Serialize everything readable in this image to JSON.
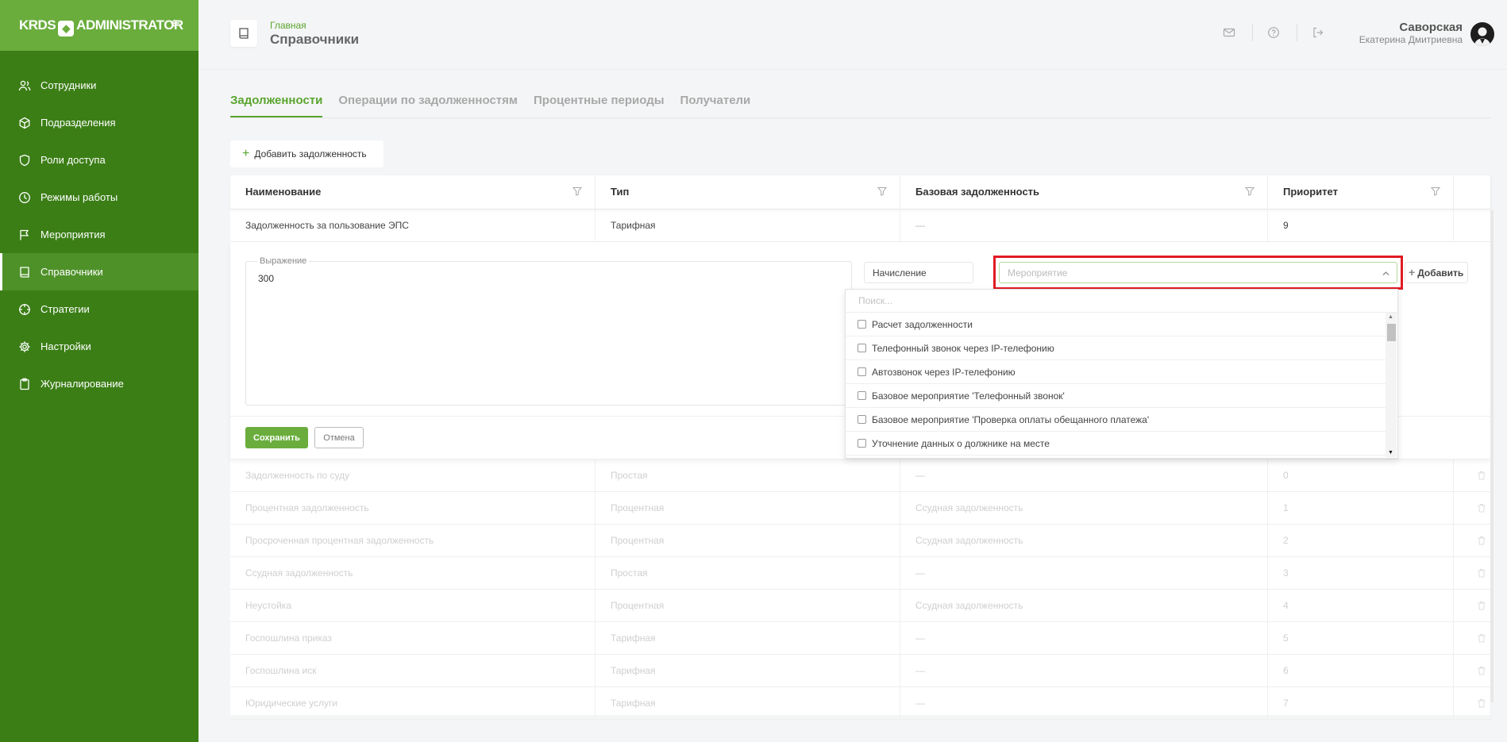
{
  "brand": {
    "logo_left": "KRDS",
    "logo_right": "ADMINISTRATOR",
    "collapse_icon": "arrow-left-icon"
  },
  "sidebar": {
    "items": [
      {
        "label": "Сотрудники",
        "icon": "users-icon",
        "active": false
      },
      {
        "label": "Подразделения",
        "icon": "cube-icon",
        "active": false
      },
      {
        "label": "Роли доступа",
        "icon": "shield-icon",
        "active": false
      },
      {
        "label": "Режимы работы",
        "icon": "clock-icon",
        "active": false
      },
      {
        "label": "Мероприятия",
        "icon": "flag-icon",
        "active": false
      },
      {
        "label": "Справочники",
        "icon": "book-icon",
        "active": true
      },
      {
        "label": "Стратегии",
        "icon": "crosshair-icon",
        "active": false
      },
      {
        "label": "Настройки",
        "icon": "gear-icon",
        "active": false
      },
      {
        "label": "Журналирование",
        "icon": "clipboard-icon",
        "active": false
      }
    ]
  },
  "header": {
    "breadcrumb_home": "Главная",
    "page_title": "Справочники",
    "user_last_name": "Саворская",
    "user_first_name": "Екатерина Дмитриевна"
  },
  "tabs": [
    {
      "label": "Задолженности",
      "active": true
    },
    {
      "label": "Операции по задолженностям",
      "active": false
    },
    {
      "label": "Процентные периоды",
      "active": false
    },
    {
      "label": "Получатели",
      "active": false
    }
  ],
  "add_button": {
    "label": "Добавить задолженность"
  },
  "table": {
    "columns": [
      "Наименование",
      "Тип",
      "Базовая задолженность",
      "Приоритет"
    ],
    "expanded_row": {
      "name": "Задолженность за пользование ЭПС",
      "type": "Тарифная",
      "base": "—",
      "priority": "9"
    },
    "rows": [
      {
        "name": "Задолженность по суду",
        "type": "Простая",
        "base": "—",
        "priority": "0"
      },
      {
        "name": "Процентная задолженность",
        "type": "Процентная",
        "base": "Ссудная задолженность",
        "priority": "1"
      },
      {
        "name": "Просроченная процентная задолженность",
        "type": "Процентная",
        "base": "Ссудная задолженность",
        "priority": "2"
      },
      {
        "name": "Ссудная задолженность",
        "type": "Простая",
        "base": "—",
        "priority": "3"
      },
      {
        "name": "Неустойка",
        "type": "Процентная",
        "base": "Ссудная задолженность",
        "priority": "4"
      },
      {
        "name": "Госпошлина приказ",
        "type": "Тарифная",
        "base": "—",
        "priority": "5"
      },
      {
        "name": "Госпошлина иск",
        "type": "Тарифная",
        "base": "—",
        "priority": "6"
      },
      {
        "name": "Юридические услуги",
        "type": "Тарифная",
        "base": "—",
        "priority": "7"
      }
    ]
  },
  "edit_form": {
    "expression_label": "Выражение",
    "expression_value": "300",
    "accrual_select": "Начисление",
    "event_placeholder": "Мероприятие",
    "add_label": "Добавить",
    "save_label": "Сохранить",
    "cancel_label": "Отмена"
  },
  "dropdown": {
    "search_placeholder": "Поиск...",
    "options": [
      "Расчет задолженности",
      "Телефонный звонок через IP-телефонию",
      "Автозвонок через IP-телефонию",
      "Базовое мероприятие 'Телефонный звонок'",
      "Базовое мероприятие 'Проверка оплаты обещанного платежа'",
      "Уточнение данных о должнике на месте"
    ]
  },
  "colors": {
    "sidebar": "#3b7e16",
    "logo_bar": "#6aad3d",
    "accent": "#5aa52f",
    "highlight": "#e01b24"
  }
}
